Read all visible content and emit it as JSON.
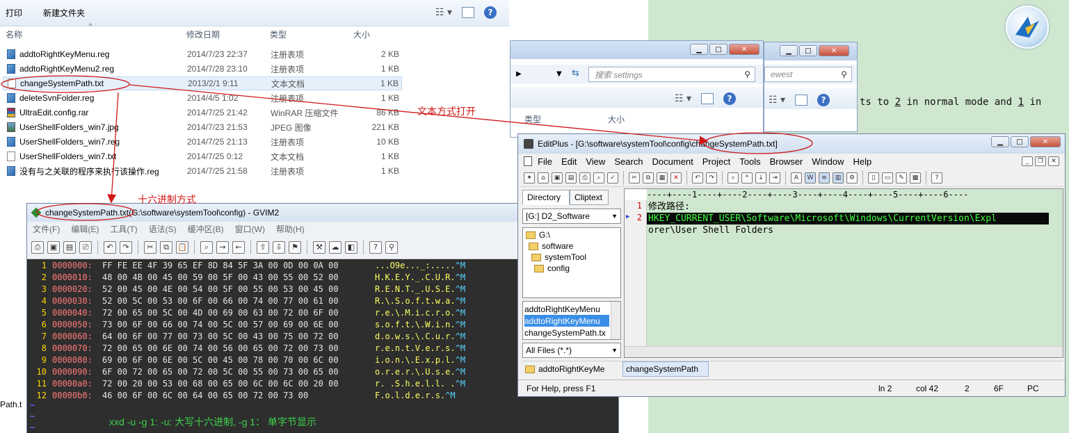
{
  "explorer": {
    "toolbar": {
      "print": "打印",
      "new_folder": "新建文件夹"
    },
    "columns": {
      "name": "名称",
      "date": "修改日期",
      "type": "类型",
      "size": "大小"
    },
    "files": [
      {
        "name": "addtoRightKeyMenu.reg",
        "date": "2014/7/23 22:37",
        "type": "注册表项",
        "size": "2 KB",
        "icon": "reg"
      },
      {
        "name": "addtoRightKeyMenu2.reg",
        "date": "2014/7/28 23:10",
        "type": "注册表项",
        "size": "1 KB",
        "icon": "reg"
      },
      {
        "name": "changeSystemPath.txt",
        "date": "2013/2/1 9:11",
        "type": "文本文档",
        "size": "1 KB",
        "icon": "txt"
      },
      {
        "name": "deleteSvnFolder.reg",
        "date": "2014/4/5 1:02",
        "type": "注册表项",
        "size": "1 KB",
        "icon": "reg"
      },
      {
        "name": "UltraEdit.config.rar",
        "date": "2014/7/25 21:42",
        "type": "WinRAR 压缩文件",
        "size": "86 KB",
        "icon": "rar"
      },
      {
        "name": "UserShellFolders_win7.jpg",
        "date": "2014/7/23 21:53",
        "type": "JPEG 图像",
        "size": "221 KB",
        "icon": "jpg"
      },
      {
        "name": "UserShellFolders_win7.reg",
        "date": "2014/7/25 21:13",
        "type": "注册表项",
        "size": "10 KB",
        "icon": "reg"
      },
      {
        "name": "UserShellFolders_win7.txt",
        "date": "2014/7/25 0:12",
        "type": "文本文档",
        "size": "1 KB",
        "icon": "txt"
      },
      {
        "name": "没有与之关联的程序来执行该操作.reg",
        "date": "2014/7/25 21:58",
        "type": "注册表项",
        "size": "1 KB",
        "icon": "reg"
      }
    ]
  },
  "middle_windows": {
    "search_settings": "搜索 settings",
    "search_newest": "ewest",
    "col_type": "类型",
    "col_size": "大小"
  },
  "background_vim": {
    "line1_a": "ts to ",
    "line1_b": "2",
    "line1_c": " in normal mode and ",
    "line1_d": "1",
    "line1_e": " in"
  },
  "left_edge_text": "Path.t",
  "annotations": {
    "text_open": "文本方式打开",
    "hex_open": "十六进制方式"
  },
  "gvim": {
    "title_file": "changeSystemPath.txt",
    "title_rest": " (G:\\software\\systemTool\\config) - GVIM2",
    "menu": [
      "文件(F)",
      "编辑(E)",
      "工具(T)",
      "语法(S)",
      "缓冲区(B)",
      "窗口(W)",
      "帮助(H)"
    ],
    "hex_rows": [
      {
        "ln": "1",
        "addr": "0000000:",
        "hex": "FF FE EE 4F 39 65 EF 8D 84 5F 3A 00 0D 00 0A 00",
        "ascii": "...O9e..._:.....",
        "ctl": "^M"
      },
      {
        "ln": "2",
        "addr": "0000010:",
        "hex": "48 00 4B 00 45 00 59 00 5F 00 43 00 55 00 52 00",
        "ascii": "H.K.E.Y._.C.U.R.",
        "ctl": "^M"
      },
      {
        "ln": "3",
        "addr": "0000020:",
        "hex": "52 00 45 00 4E 00 54 00 5F 00 55 00 53 00 45 00",
        "ascii": "R.E.N.T._.U.S.E.",
        "ctl": "^M"
      },
      {
        "ln": "4",
        "addr": "0000030:",
        "hex": "52 00 5C 00 53 00 6F 00 66 00 74 00 77 00 61 00",
        "ascii": "R.\\.S.o.f.t.w.a.",
        "ctl": "^M"
      },
      {
        "ln": "5",
        "addr": "0000040:",
        "hex": "72 00 65 00 5C 00 4D 00 69 00 63 00 72 00 6F 00",
        "ascii": "r.e.\\.M.i.c.r.o.",
        "ctl": "^M"
      },
      {
        "ln": "6",
        "addr": "0000050:",
        "hex": "73 00 6F 00 66 00 74 00 5C 00 57 00 69 00 6E 00",
        "ascii": "s.o.f.t.\\.W.i.n.",
        "ctl": "^M"
      },
      {
        "ln": "7",
        "addr": "0000060:",
        "hex": "64 00 6F 00 77 00 73 00 5C 00 43 00 75 00 72 00",
        "ascii": "d.o.w.s.\\.C.u.r.",
        "ctl": "^M"
      },
      {
        "ln": "8",
        "addr": "0000070:",
        "hex": "72 00 65 00 6E 00 74 00 56 00 65 00 72 00 73 00",
        "ascii": "r.e.n.t.V.e.r.s.",
        "ctl": "^M"
      },
      {
        "ln": "9",
        "addr": "0000080:",
        "hex": "69 00 6F 00 6E 00 5C 00 45 00 78 00 70 00 6C 00",
        "ascii": "i.o.n.\\.E.x.p.l.",
        "ctl": "^M"
      },
      {
        "ln": "10",
        "addr": "0000090:",
        "hex": "6F 00 72 00 65 00 72 00 5C 00 55 00 73 00 65 00",
        "ascii": "o.r.e.r.\\.U.s.e.",
        "ctl": "^M"
      },
      {
        "ln": "11",
        "addr": "00000a0:",
        "hex": "72 00 20 00 53 00 68 00 65 00 6C 00 6C 00 20 00",
        "ascii": "r. .S.h.e.l.l. .",
        "ctl": "^M"
      },
      {
        "ln": "12",
        "addr": "00000b0:",
        "hex": "46 00 6F 00 6C 00 64 00 65 00 72 00 73 00",
        "ascii": "F.o.l.d.e.r.s.",
        "ctl": "^M"
      }
    ],
    "tilde": "~",
    "note": "xxd -u -g 1: -u: 大写十六进制, -g 1： 单字节显示"
  },
  "editplus": {
    "title_prefix": "EditPlus - [G:\\software\\systemTool\\config\\",
    "title_file": "changeSystemPath.txt]",
    "menu": [
      "File",
      "Edit",
      "View",
      "Search",
      "Document",
      "Project",
      "Tools",
      "Browser",
      "Window",
      "Help"
    ],
    "tabs": {
      "directory": "Directory",
      "cliptext": "Cliptext"
    },
    "drive": "[G:] D2_Software",
    "tree": [
      "G:\\",
      "software",
      "systemTool",
      "config"
    ],
    "file_list": [
      "addtoRightKeyMenu",
      "addtoRightKeyMenu",
      "changeSystemPath.tx"
    ],
    "filter": "All Files (*.*)",
    "ruler": "----+----1----+----2----+----3----+----4----+----5----+----6----",
    "lines": [
      {
        "num": "1",
        "text": "修改路径:"
      },
      {
        "num": "2",
        "text": "HKEY_CURRENT_USER\\Software\\Microsoft\\Windows\\CurrentVersion\\Expl"
      },
      {
        "num": "",
        "text": "orer\\User Shell Folders"
      }
    ],
    "doc_tabs": [
      "addtoRightKeyMe",
      "changeSystemPath"
    ],
    "status": {
      "help": "For Help, press F1",
      "ln": "ln 2",
      "col": "col 42",
      "n": "2",
      "hex": "6F",
      "mode": "PC"
    }
  },
  "colors": {
    "vim_bg": "#2e2e2e",
    "editor_bg": "#cfe6cf",
    "annotation": "#d01818",
    "hex_addr": "#ff7a7a",
    "ascii": "#ffff60",
    "note": "#3fd14b"
  }
}
